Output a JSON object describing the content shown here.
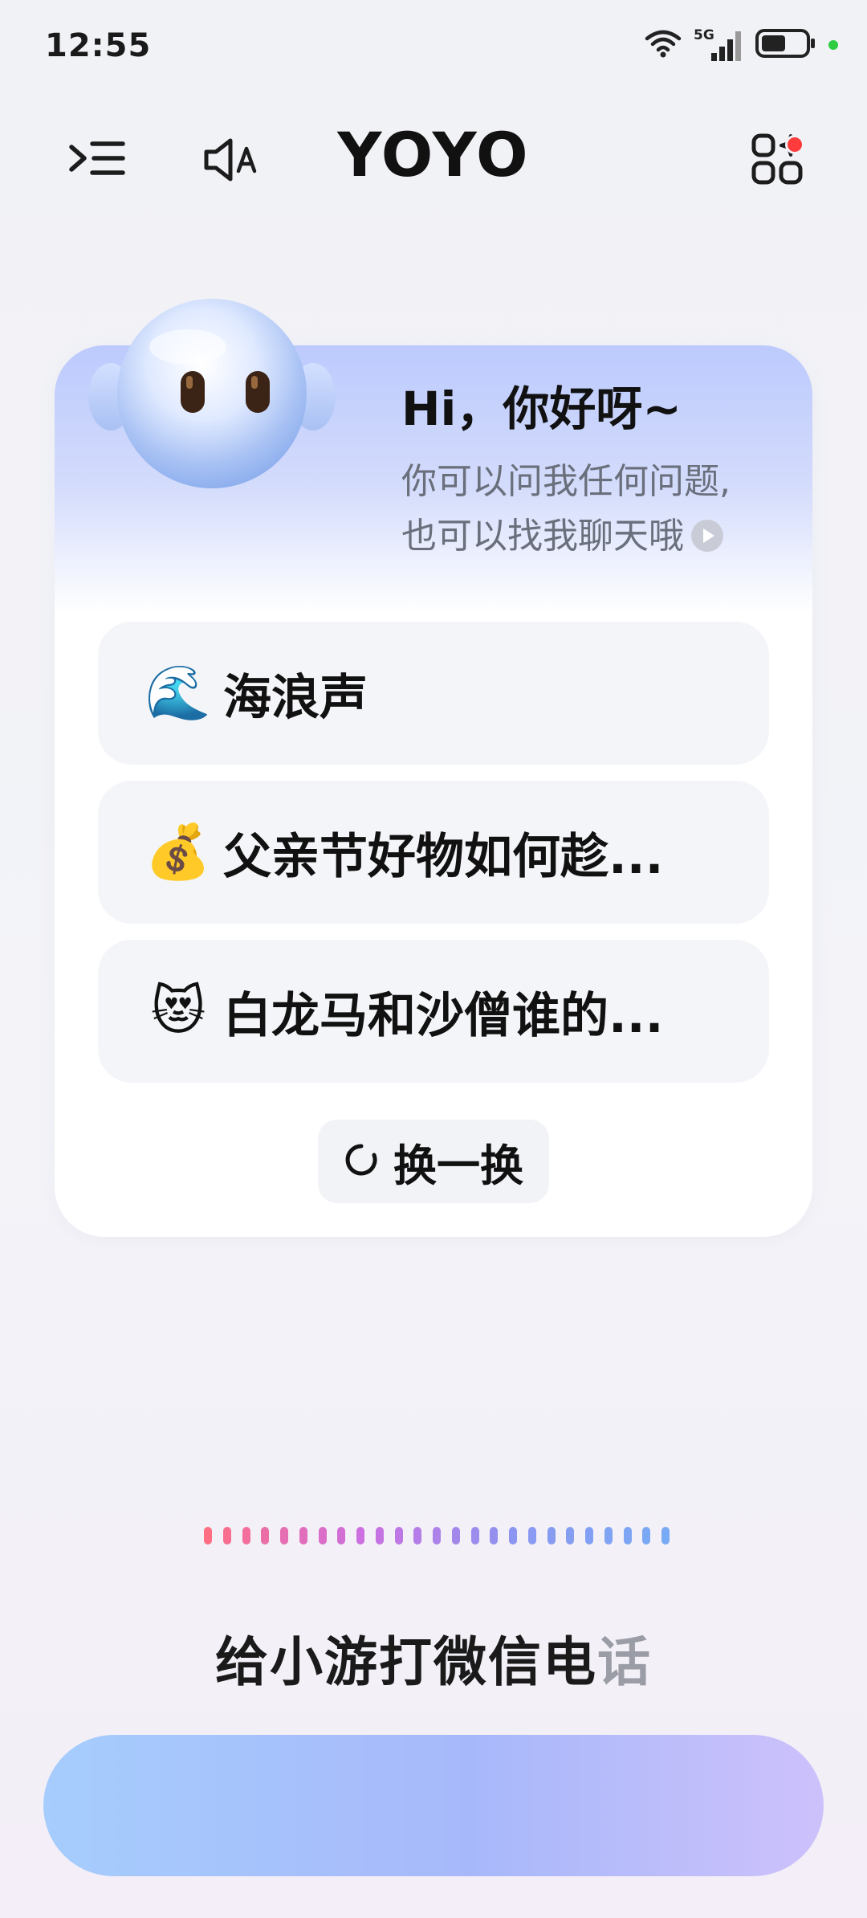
{
  "status_bar": {
    "time": "12:55",
    "network": "5G",
    "battery_level": 0.55
  },
  "header": {
    "title": "YOYO",
    "menu_icon": "menu-icon",
    "voice_text_icon": "speaker-text-icon",
    "apps_icon": "apps-icon",
    "has_notification": true
  },
  "greeting": {
    "title": "Hi，你好呀~",
    "subtitle_line1": "你可以问我任何问题,",
    "subtitle_line2": "也可以找我聊天哦"
  },
  "suggestions": [
    {
      "emoji": "🌊",
      "label": "海浪声"
    },
    {
      "emoji": "💰",
      "label": "父亲节好物如何趁..."
    },
    {
      "emoji": "😻",
      "label": "白龙马和沙僧谁的..."
    }
  ],
  "refresh": {
    "label": "换一换"
  },
  "hint": {
    "text_main": "给小游打微信电",
    "text_faded": "话"
  },
  "colors": {
    "accent_blue": "#a6cdfd",
    "accent_purple": "#cdc1fb",
    "notification": "#ff3b3b",
    "battery_indicator": "#2ecc40"
  }
}
